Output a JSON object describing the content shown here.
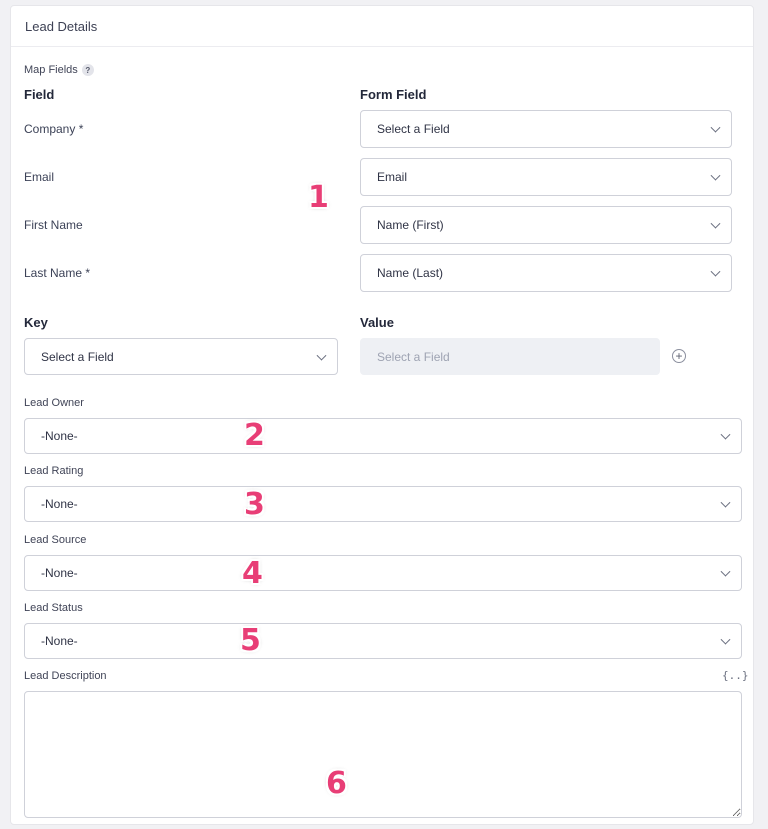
{
  "panel": {
    "title": "Lead Details"
  },
  "map_fields": {
    "label": "Map Fields",
    "help": "?",
    "col_field": "Field",
    "col_form_field": "Form Field",
    "rows": [
      {
        "field": "Company *",
        "value": "Select a Field"
      },
      {
        "field": "Email",
        "value": "Email"
      },
      {
        "field": "First Name",
        "value": "Name (First)"
      },
      {
        "field": "Last Name *",
        "value": "Name (Last)"
      }
    ]
  },
  "custom": {
    "key_label": "Key",
    "value_label": "Value",
    "key_value": "Select a Field",
    "value_placeholder": "Select a Field",
    "add": "+"
  },
  "lead_owner": {
    "label": "Lead Owner",
    "value": "-None-"
  },
  "lead_rating": {
    "label": "Lead Rating",
    "value": "-None-"
  },
  "lead_source": {
    "label": "Lead Source",
    "value": "-None-"
  },
  "lead_status": {
    "label": "Lead Status",
    "value": "-None-"
  },
  "lead_description": {
    "label": "Lead Description",
    "merge_tag_icon": "{..}"
  },
  "annotations": [
    "1",
    "2",
    "3",
    "4",
    "5",
    "6"
  ],
  "colors": {
    "annotation": "#e83e76"
  }
}
